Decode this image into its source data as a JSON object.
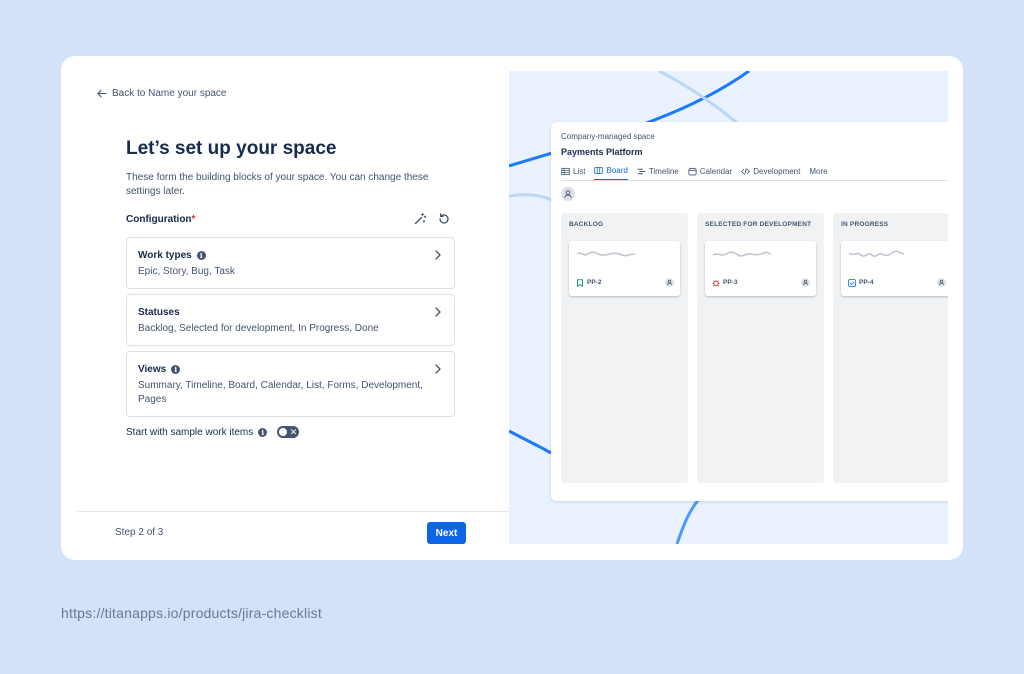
{
  "wizard": {
    "back_label": "Back to Name your space",
    "title": "Let’s set up your space",
    "description": "These form the building blocks of your space. You can change these settings later.",
    "config_label": "Configuration",
    "required_mark": "*",
    "options": [
      {
        "title": "Work types",
        "has_info": true,
        "subtitle": "Epic, Story, Bug, Task"
      },
      {
        "title": "Statuses",
        "has_info": false,
        "subtitle": "Backlog, Selected for development, In Progress, Done"
      },
      {
        "title": "Views",
        "has_info": true,
        "subtitle": "Summary, Timeline, Board, Calendar, List, Forms, Development, Pages"
      }
    ],
    "sample_label": "Start with sample work items",
    "sample_enabled": false,
    "step_label": "Step 2 of 3",
    "next_label": "Next"
  },
  "preview": {
    "space_type": "Company-managed space",
    "space_name": "Payments Platform",
    "tabs": [
      {
        "label": "List",
        "icon": "list-icon",
        "active": false
      },
      {
        "label": "Board",
        "icon": "board-icon",
        "active": true
      },
      {
        "label": "Timeline",
        "icon": "timeline-icon",
        "active": false
      },
      {
        "label": "Calendar",
        "icon": "calendar-icon",
        "active": false
      },
      {
        "label": "Development",
        "icon": "code-icon",
        "active": false
      },
      {
        "label": "More",
        "icon": "",
        "active": false
      }
    ],
    "columns": [
      {
        "title": "BACKLOG",
        "ticket_key": "PP-2",
        "ticket_type": "story",
        "ticket_color": "#22a06b"
      },
      {
        "title": "SELECTED FOR DEVELOPMENT",
        "ticket_key": "PP-3",
        "ticket_type": "bug",
        "ticket_color": "#c9372c"
      },
      {
        "title": "IN PROGRESS",
        "ticket_key": "PP-4",
        "ticket_type": "task",
        "ticket_color": "#1d7afc"
      }
    ]
  },
  "footer_url": "https://titanapps.io/products/jira-checklist",
  "colors": {
    "page_bg": "#d3e2f8",
    "accent": "#0c66e4",
    "preview_bg": "#e9f2fe"
  }
}
